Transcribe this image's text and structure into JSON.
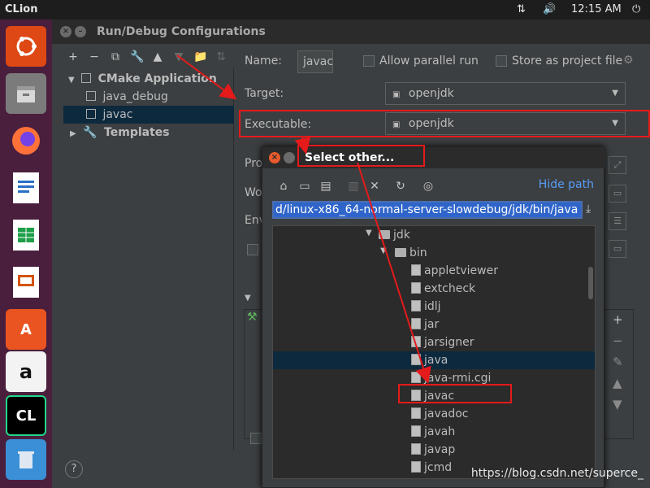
{
  "topbar": {
    "app": "CLion",
    "time": "12:15 AM",
    "network_icon": "network-icon",
    "volume_icon": "volume-icon",
    "power_icon": "power-icon"
  },
  "launcher": {
    "items": [
      {
        "name": "ubuntu-icon",
        "label": "",
        "color": "#dd4814"
      },
      {
        "name": "files-icon",
        "label": "",
        "color": "#8c8c8c"
      },
      {
        "name": "firefox-icon",
        "label": "",
        "color": "#ff7139"
      },
      {
        "name": "writer-icon",
        "label": "",
        "color": "#2a70c3"
      },
      {
        "name": "calc-icon",
        "label": "",
        "color": "#1e9e48"
      },
      {
        "name": "impress-icon",
        "label": "",
        "color": "#d35400"
      },
      {
        "name": "software-icon",
        "label": "A",
        "color": "#e95420"
      },
      {
        "name": "amazon-icon",
        "label": "a",
        "color": "#f3f3f3"
      },
      {
        "name": "clion-icon",
        "label": "CL",
        "color": "#000000"
      },
      {
        "name": "trash-icon",
        "label": "",
        "color": "#5a5a5a"
      }
    ]
  },
  "dialog": {
    "title": "Run/Debug Configurations",
    "tree": {
      "group": "CMake Application",
      "children": [
        "java_debug",
        "javac"
      ],
      "templates": "Templates"
    },
    "name_label": "Name:",
    "name_value": "javac",
    "allow_parallel": "Allow parallel run",
    "store_as_file": "Store as project file",
    "target_label": "Target:",
    "target_value": "openjdk",
    "executable_label": "Executable:",
    "executable_value": "openjdk",
    "partial_labels": [
      "Pro",
      "Wo",
      "Env"
    ]
  },
  "file_chooser": {
    "title": "Select other...",
    "hide_path": "Hide path",
    "path": "d/linux-x86_64-normal-server-slowdebug/jdk/bin/java",
    "folders": [
      "jdk",
      "bin"
    ],
    "files": [
      "appletviewer",
      "extcheck",
      "idlj",
      "jar",
      "jarsigner",
      "java",
      "java-rmi.cgi",
      "javac",
      "javadoc",
      "javah",
      "javap",
      "jcmd"
    ],
    "selected": "java",
    "highlighted": "javac"
  },
  "watermark": "https://blog.csdn.net/superce_",
  "help": "?",
  "colors": {
    "annotation": "#e51a1a",
    "selection": "#0d293e",
    "link": "#589df6",
    "path_bg": "#2f65ca"
  }
}
